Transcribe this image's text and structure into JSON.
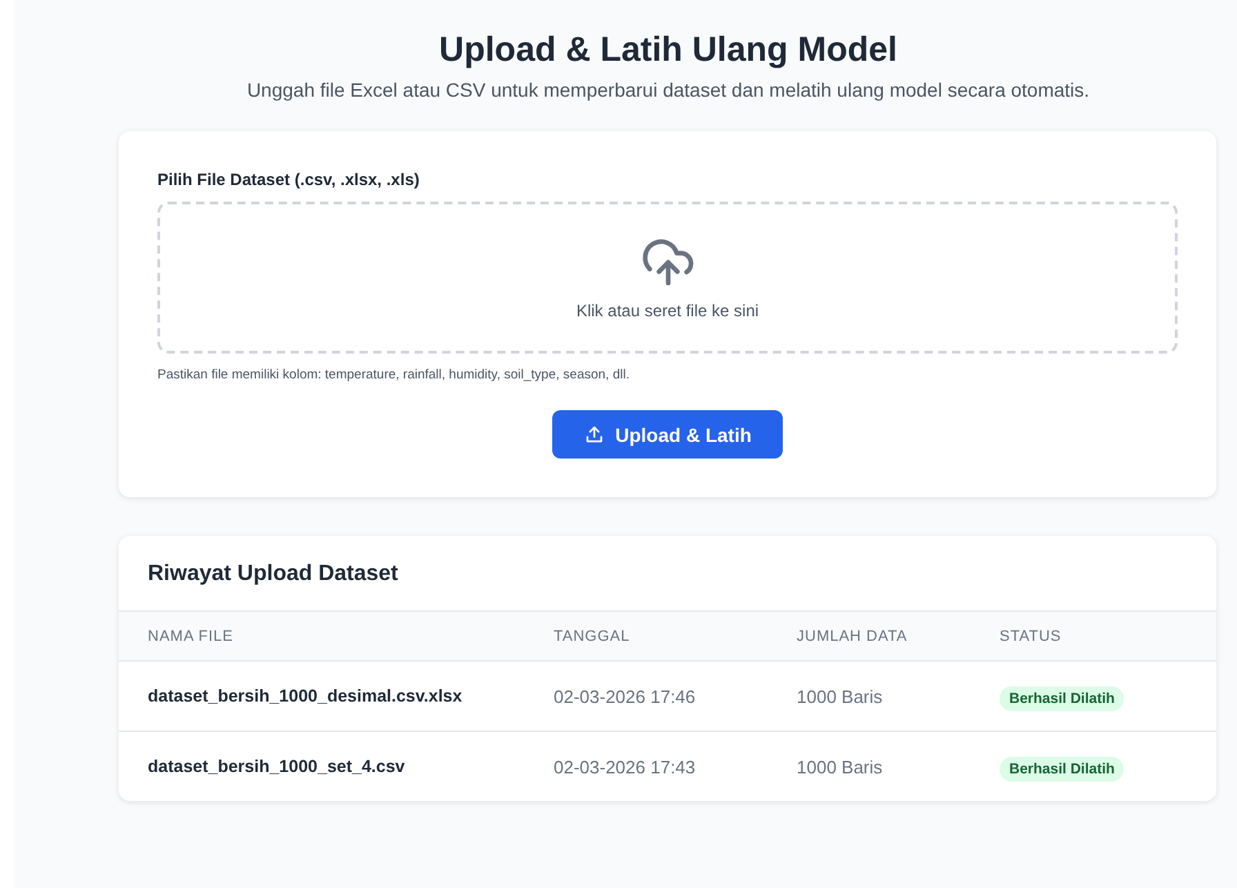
{
  "header": {
    "title": "Upload & Latih Ulang Model",
    "subtitle": "Unggah file Excel atau CSV untuk memperbarui dataset dan melatih ulang model secara otomatis."
  },
  "upload": {
    "label": "Pilih File Dataset (.csv, .xlsx, .xls)",
    "dropzone_text": "Klik atau seret file ke sini",
    "hint": "Pastikan file memiliki kolom: temperature, rainfall, humidity, soil_type, season, dll.",
    "button": "Upload & Latih"
  },
  "history": {
    "title": "Riwayat Upload Dataset",
    "columns": [
      "NAMA FILE",
      "TANGGAL",
      "JUMLAH DATA",
      "STATUS"
    ],
    "rows": [
      {
        "file": "dataset_bersih_1000_desimal.csv.xlsx",
        "date": "02-03-2026 17:46",
        "count": "1000 Baris",
        "status": "Berhasil Dilatih"
      },
      {
        "file": "dataset_bersih_1000_set_4.csv",
        "date": "02-03-2026 17:43",
        "count": "1000 Baris",
        "status": "Berhasil Dilatih"
      }
    ]
  }
}
